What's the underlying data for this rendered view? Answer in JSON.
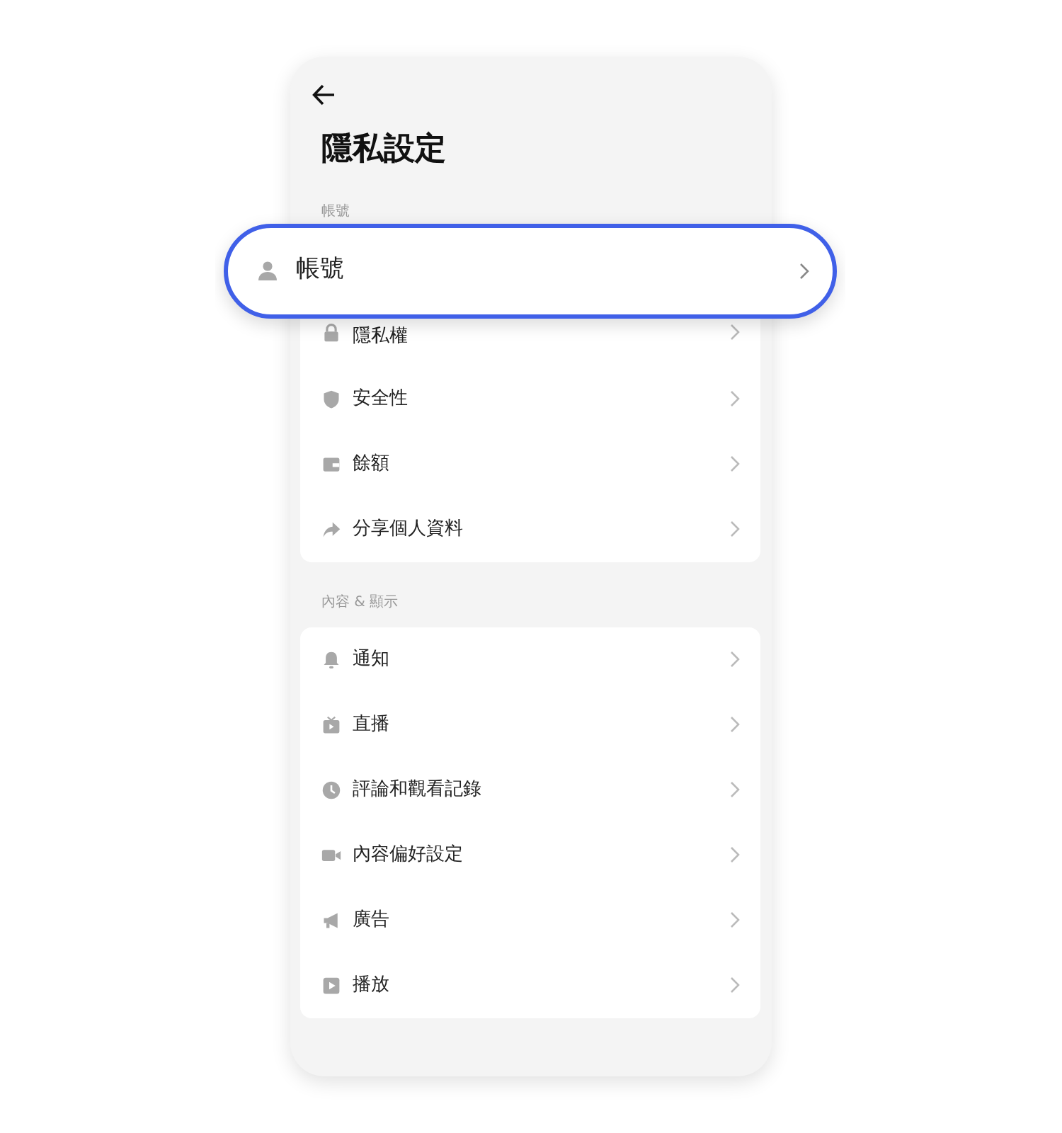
{
  "title": "隱私設定",
  "sections": [
    {
      "label": "帳號",
      "items": [
        {
          "label": "帳號",
          "highlighted": true
        },
        {
          "label": "隱私權",
          "highlighted": false
        },
        {
          "label": "安全性",
          "highlighted": false
        },
        {
          "label": "餘額",
          "highlighted": false
        },
        {
          "label": "分享個人資料",
          "highlighted": false
        }
      ]
    },
    {
      "label": "內容 & 顯示",
      "items": [
        {
          "label": "通知",
          "highlighted": false
        },
        {
          "label": "直播",
          "highlighted": false
        },
        {
          "label": "評論和觀看記錄",
          "highlighted": false
        },
        {
          "label": "內容偏好設定",
          "highlighted": false
        },
        {
          "label": "廣告",
          "highlighted": false
        },
        {
          "label": "播放",
          "highlighted": false
        }
      ]
    }
  ]
}
